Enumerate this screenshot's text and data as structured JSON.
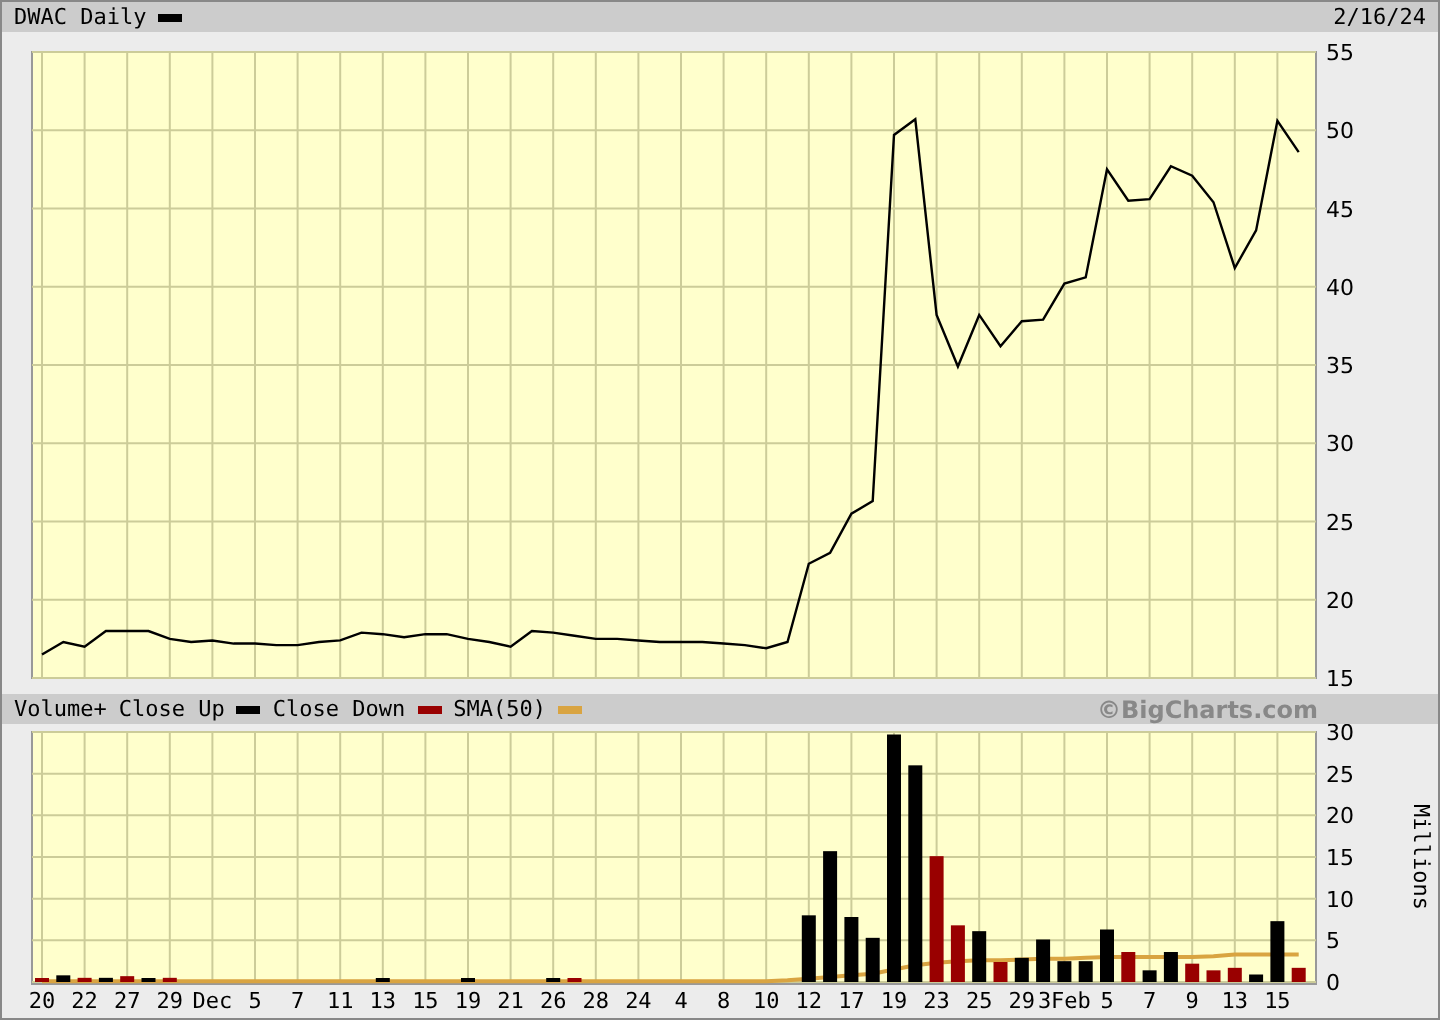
{
  "header": {
    "title": "DWAC Daily",
    "date": "2/16/24"
  },
  "price_chart": {
    "chart_data": {
      "type": "line",
      "grid": true,
      "ylim": [
        15,
        55
      ],
      "yticks": [
        15,
        20,
        25,
        30,
        35,
        40,
        45,
        50,
        55
      ],
      "series": [
        {
          "color": "#000000",
          "values": [
            16.5,
            17.3,
            17.0,
            18.0,
            18.0,
            18.0,
            17.5,
            17.3,
            17.4,
            17.2,
            17.2,
            17.1,
            17.1,
            17.3,
            17.4,
            17.9,
            17.8,
            17.6,
            17.8,
            17.8,
            17.5,
            17.3,
            17.0,
            18.0,
            17.9,
            17.7,
            17.5,
            17.5,
            17.4,
            17.3,
            17.3,
            17.3,
            17.2,
            17.1,
            16.9,
            17.3,
            22.3,
            23.0,
            25.5,
            26.3,
            49.7,
            50.7,
            38.2,
            34.9,
            38.2,
            36.2,
            37.8,
            37.9,
            40.2,
            40.6,
            47.5,
            45.5,
            45.6,
            47.7,
            47.1,
            45.4,
            41.2,
            43.6,
            50.6,
            48.6
          ]
        }
      ]
    }
  },
  "legend": {
    "title": "Volume+",
    "copyright": "©BigCharts.com"
  },
  "volume_chart": {
    "chart_data": {
      "type": "bar",
      "grid": true,
      "ylabel": "Millions",
      "ylim": [
        0,
        30
      ],
      "yticks": [
        0,
        5,
        10,
        15,
        20,
        25,
        30
      ],
      "series": [
        {
          "name": "Close Up",
          "color": "#000000",
          "type": "bar",
          "values": [
            null,
            0.8,
            null,
            0.5,
            null,
            0.3,
            null,
            null,
            null,
            null,
            null,
            null,
            null,
            null,
            null,
            null,
            0.3,
            null,
            null,
            null,
            0.3,
            null,
            null,
            null,
            0.3,
            null,
            null,
            null,
            null,
            null,
            null,
            null,
            null,
            null,
            null,
            null,
            8.0,
            15.7,
            7.8,
            5.3,
            29.7,
            26.0,
            null,
            null,
            6.1,
            null,
            2.9,
            5.1,
            2.5,
            2.5,
            6.3,
            null,
            1.4,
            3.6,
            null,
            null,
            null,
            0.9,
            7.3,
            null
          ]
        },
        {
          "name": "Close Down",
          "color": "#990000",
          "type": "bar",
          "values": [
            0.3,
            null,
            0.5,
            null,
            0.7,
            null,
            0.5,
            null,
            null,
            null,
            null,
            null,
            null,
            null,
            null,
            null,
            null,
            null,
            null,
            null,
            null,
            null,
            null,
            null,
            null,
            0.4,
            null,
            null,
            null,
            null,
            null,
            null,
            null,
            null,
            null,
            null,
            null,
            null,
            null,
            null,
            null,
            null,
            15.1,
            6.8,
            null,
            2.4,
            null,
            null,
            null,
            null,
            null,
            3.6,
            null,
            null,
            2.2,
            1.4,
            1.7,
            null,
            null,
            1.7
          ]
        },
        {
          "name": "SMA(50)",
          "color": "#d9a441",
          "type": "line",
          "values": [
            0.1,
            0.1,
            0.1,
            0.1,
            0.1,
            0.1,
            0.1,
            0.1,
            0.1,
            0.1,
            0.1,
            0.1,
            0.1,
            0.1,
            0.1,
            0.1,
            0.1,
            0.1,
            0.1,
            0.1,
            0.1,
            0.1,
            0.1,
            0.1,
            0.1,
            0.1,
            0.1,
            0.1,
            0.1,
            0.1,
            0.1,
            0.1,
            0.1,
            0.1,
            0.1,
            0.2,
            0.4,
            0.6,
            0.8,
            1.0,
            1.5,
            2.0,
            2.3,
            2.5,
            2.6,
            2.6,
            2.7,
            2.8,
            2.8,
            2.9,
            3.0,
            3.0,
            3.0,
            3.0,
            3.0,
            3.1,
            3.3,
            3.3,
            3.3,
            3.3
          ]
        }
      ]
    },
    "date_labels": [
      "20",
      "22",
      "27",
      "29",
      "Dec",
      "5",
      "7",
      "11",
      "13",
      "15",
      "19",
      "21",
      "26",
      "28",
      "24",
      "4",
      "8",
      "10",
      "12",
      "17",
      "19",
      "23",
      "25",
      "29",
      "3Feb",
      "5",
      "7",
      "9",
      "13",
      "15"
    ]
  }
}
